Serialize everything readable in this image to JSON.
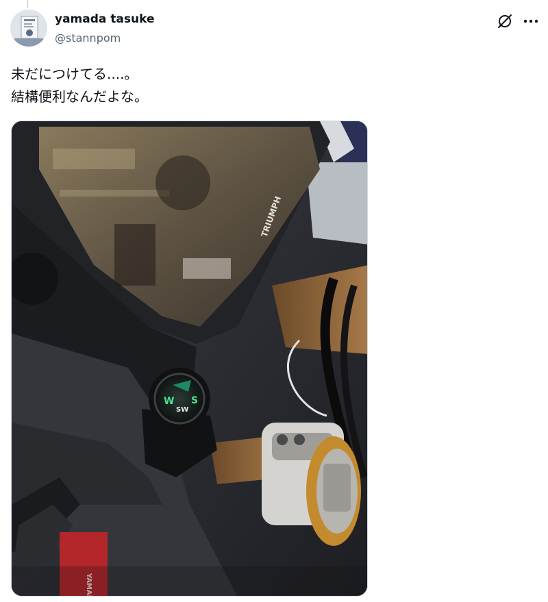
{
  "post": {
    "author": {
      "display_name": "yamada tasuke",
      "handle": "@stannpom",
      "avatar_icon": "user-avatar"
    },
    "text_lines": [
      "未だにつけてる....。",
      "結構便利なんだよな。"
    ],
    "actions": {
      "grok_icon": "grok-slash-icon",
      "more_icon": "more-horizontal-icon"
    },
    "media": {
      "description_icon": "photo",
      "mirror_brand": "TRIUMPH",
      "compass_letters": [
        "W",
        "SW",
        "S"
      ]
    }
  }
}
